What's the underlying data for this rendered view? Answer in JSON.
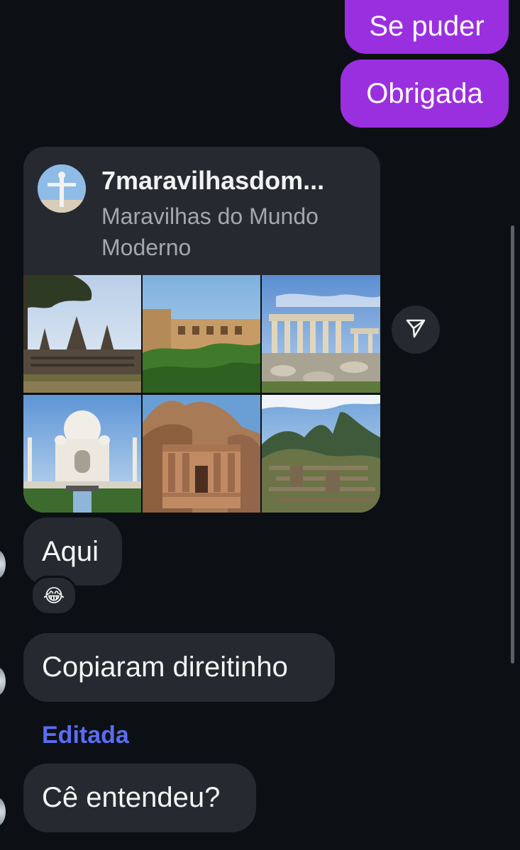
{
  "outgoing": [
    {
      "text": "Se puder"
    },
    {
      "text": "Obrigada"
    }
  ],
  "shared_post": {
    "username": "7maravilhasdom...",
    "caption": "Maravilhas do Mundo Moderno",
    "photos": [
      {
        "subject": "Angkor Wat"
      },
      {
        "subject": "Alhambra"
      },
      {
        "subject": "Acropolis"
      },
      {
        "subject": "Taj Mahal"
      },
      {
        "subject": "Petra"
      },
      {
        "subject": "Machu Picchu"
      }
    ]
  },
  "incoming": [
    {
      "text": "Aqui",
      "reaction": "😂"
    },
    {
      "text": "Copiaram direitinho"
    },
    {
      "text": "Cê entendeu?",
      "label": "Editada"
    }
  ],
  "icons": {
    "share": "send-icon"
  },
  "colors": {
    "background": "#0c1014",
    "outgoing_bubble": "#9a2fe0",
    "incoming_bubble": "#262a30",
    "edited_label": "#5b6cf2"
  }
}
